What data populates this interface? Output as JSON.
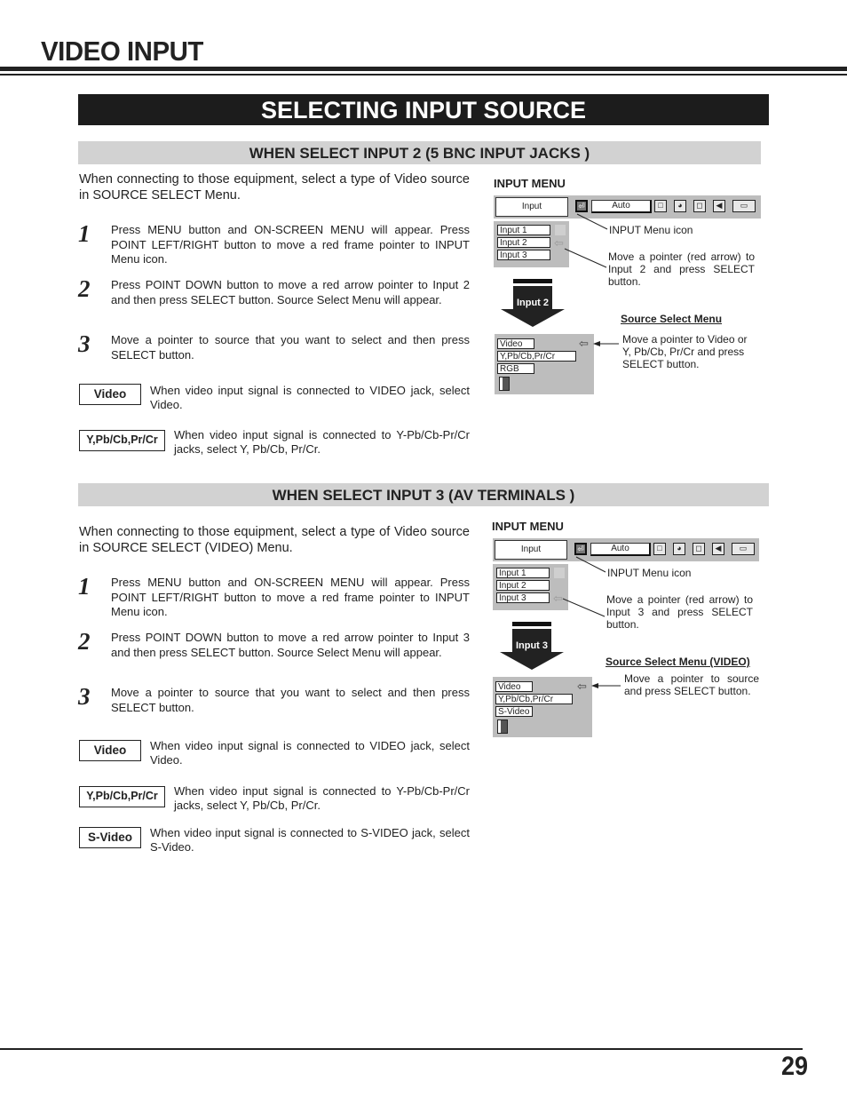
{
  "page": {
    "title": "VIDEO INPUT",
    "banner": "SELECTING INPUT SOURCE",
    "page_number": "29"
  },
  "section1": {
    "heading": "WHEN SELECT INPUT 2 (5 BNC INPUT JACKS )",
    "intro": "When connecting to those equipment, select a type of Video source in SOURCE SELECT Menu.",
    "steps": [
      {
        "num": "1",
        "text": "Press MENU button and ON-SCREEN MENU will appear.  Press POINT LEFT/RIGHT button to move a red frame pointer to INPUT Menu icon."
      },
      {
        "num": "2",
        "text": "Press POINT DOWN button to move a red arrow pointer to Input 2 and then press SELECT button.  Source Select Menu will appear."
      },
      {
        "num": "3",
        "text": "Move a pointer to source that you want to select and then press SELECT button."
      }
    ],
    "options": [
      {
        "label": "Video",
        "desc": "When video input signal is connected to VIDEO jack, select Video."
      },
      {
        "label": "Y,Pb/Cb,Pr/Cr",
        "desc": "When video input signal is connected to Y-Pb/Cb-Pr/Cr jacks, select Y, Pb/Cb, Pr/Cr."
      }
    ],
    "diagram": {
      "input_menu_label": "INPUT MENU",
      "osd_input": "Input",
      "osd_auto": "Auto",
      "inputs": [
        "Input 1",
        "Input 2",
        "Input 3"
      ],
      "caption_icon": "INPUT Menu icon",
      "caption_pointer": "Move a pointer (red arrow) to Input 2 and press SELECT button.",
      "arrow_label": "Input 2",
      "source_menu_title": "Source Select Menu",
      "sources": [
        "Video",
        "Y,Pb/Cb,Pr/Cr",
        "RGB"
      ],
      "caption_source": "Move a pointer to Video or Y, Pb/Cb, Pr/Cr and press SELECT button."
    }
  },
  "section2": {
    "heading": "WHEN SELECT INPUT 3 (AV TERMINALS )",
    "intro": "When connecting to those equipment, select a type of Video source in SOURCE SELECT (VIDEO) Menu.",
    "steps": [
      {
        "num": "1",
        "text": "Press MENU button and ON-SCREEN MENU will appear.  Press POINT LEFT/RIGHT button to move a red frame pointer to INPUT Menu icon."
      },
      {
        "num": "2",
        "text": "Press POINT DOWN button to move a red arrow pointer to Input 3 and then press SELECT button.  Source Select Menu will appear."
      },
      {
        "num": "3",
        "text": "Move a pointer to source that you want to select and then press SELECT button."
      }
    ],
    "options": [
      {
        "label": "Video",
        "desc": "When video input signal is connected to VIDEO jack, select Video."
      },
      {
        "label": "Y,Pb/Cb,Pr/Cr",
        "desc": "When video input signal is connected to Y-Pb/Cb-Pr/Cr jacks, select Y, Pb/Cb, Pr/Cr."
      },
      {
        "label": "S-Video",
        "desc": "When video input signal is connected to S-VIDEO jack, select S-Video."
      }
    ],
    "diagram": {
      "input_menu_label": "INPUT MENU",
      "osd_input": "Input",
      "osd_auto": "Auto",
      "inputs": [
        "Input 1",
        "Input 2",
        "Input 3"
      ],
      "caption_icon": "INPUT Menu icon",
      "caption_pointer": "Move a pointer (red arrow) to Input 3 and press SELECT button.",
      "arrow_label": "Input 3",
      "source_menu_title": "Source Select Menu (VIDEO)",
      "sources": [
        "Video",
        "Y,Pb/Cb,Pr/Cr",
        "S-Video"
      ],
      "caption_source": "Move a pointer to source and press SELECT button."
    }
  },
  "icons": {
    "input_icon": "⏎",
    "pointer": "⇦",
    "screen_icon": "□",
    "color_icon": "◕",
    "setting_icon": "◻",
    "sound_icon": "◀",
    "lamp_icon": "▭"
  }
}
